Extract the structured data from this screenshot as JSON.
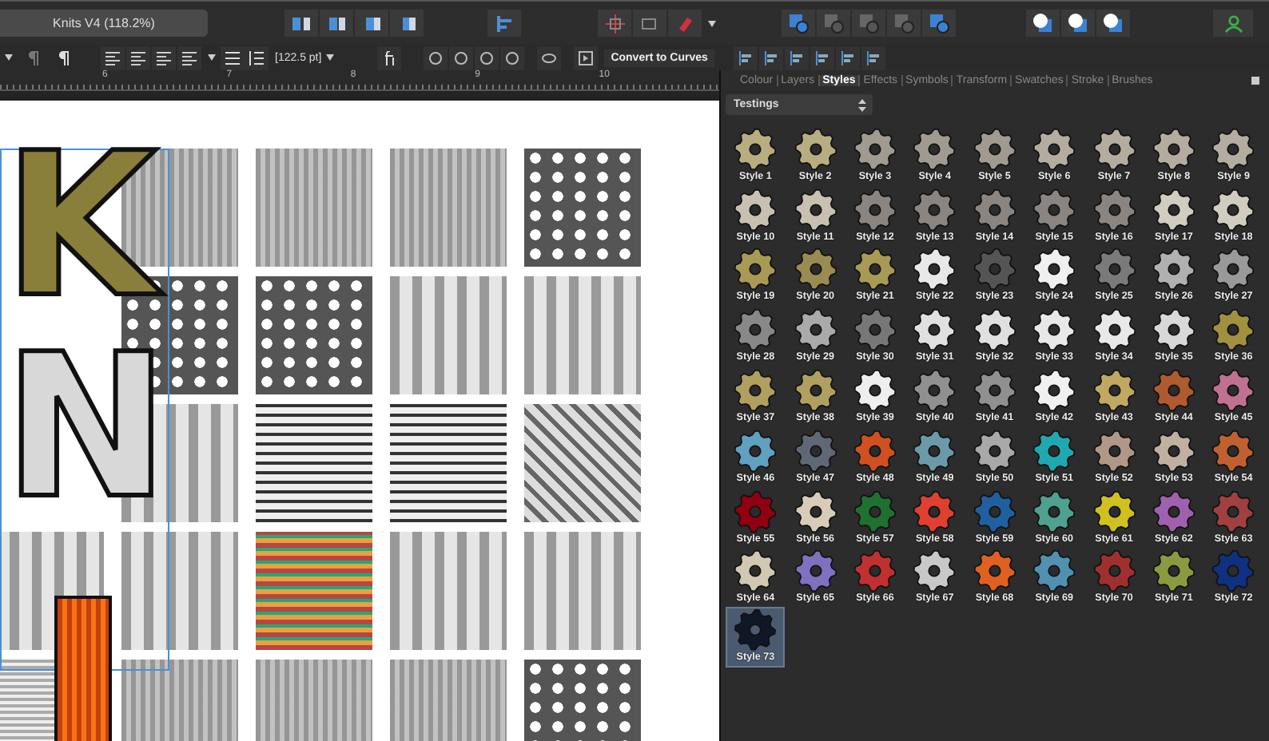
{
  "document": {
    "title": "Knits V4 (118.2%)"
  },
  "toolbar": {
    "size_field": "[122.5 pt]",
    "convert_button": "Convert to Curves"
  },
  "ruler": {
    "ticks": [
      "6",
      "7",
      "8",
      "9",
      "10"
    ]
  },
  "canvas": {
    "letters": [
      "K",
      "N"
    ]
  },
  "panel": {
    "tabs": [
      {
        "label": "Colour",
        "selected": false
      },
      {
        "label": "Layers",
        "selected": false
      },
      {
        "label": "Styles",
        "selected": true
      },
      {
        "label": "Effects",
        "selected": false
      },
      {
        "label": "Symbols",
        "selected": false
      },
      {
        "label": "Transform",
        "selected": false
      },
      {
        "label": "Swatches",
        "selected": false
      },
      {
        "label": "Stroke",
        "selected": false
      },
      {
        "label": "Brushes",
        "selected": false
      }
    ],
    "category": "Testings",
    "styles": [
      {
        "label": "Style 1",
        "color": "#b8ad80",
        "selected": false
      },
      {
        "label": "Style 2",
        "color": "#b8ad80",
        "selected": false
      },
      {
        "label": "Style 3",
        "color": "#a09a90",
        "selected": false
      },
      {
        "label": "Style 4",
        "color": "#a09a90",
        "selected": false
      },
      {
        "label": "Style 5",
        "color": "#a09a90",
        "selected": false
      },
      {
        "label": "Style 6",
        "color": "#b5aca0",
        "selected": false
      },
      {
        "label": "Style 7",
        "color": "#b5aca0",
        "selected": false
      },
      {
        "label": "Style 8",
        "color": "#b5aca0",
        "selected": false
      },
      {
        "label": "Style 9",
        "color": "#b5aca0",
        "selected": false
      },
      {
        "label": "Style 10",
        "color": "#c8c0b0",
        "selected": false
      },
      {
        "label": "Style 11",
        "color": "#c8c0b0",
        "selected": false
      },
      {
        "label": "Style 12",
        "color": "#8a8580",
        "selected": false
      },
      {
        "label": "Style 13",
        "color": "#8a8580",
        "selected": false
      },
      {
        "label": "Style 14",
        "color": "#8a8580",
        "selected": false
      },
      {
        "label": "Style 15",
        "color": "#8a8580",
        "selected": false
      },
      {
        "label": "Style 16",
        "color": "#8a8580",
        "selected": false
      },
      {
        "label": "Style 17",
        "color": "#d0ccc0",
        "selected": false
      },
      {
        "label": "Style 18",
        "color": "#d0ccc0",
        "selected": false
      },
      {
        "label": "Style 19",
        "color": "#a89a55",
        "selected": false
      },
      {
        "label": "Style 20",
        "color": "#9a8c50",
        "selected": false
      },
      {
        "label": "Style 21",
        "color": "#a89a55",
        "selected": false
      },
      {
        "label": "Style 22",
        "color": "#e8e8e8",
        "selected": false
      },
      {
        "label": "Style 23",
        "color": "#555555",
        "selected": false
      },
      {
        "label": "Style 24",
        "color": "#f0f0f0",
        "selected": false
      },
      {
        "label": "Style 25",
        "color": "#7a7a7a",
        "selected": false
      },
      {
        "label": "Style 26",
        "color": "#b0b0b0",
        "selected": false
      },
      {
        "label": "Style 27",
        "color": "#999999",
        "selected": false
      },
      {
        "label": "Style 28",
        "color": "#888888",
        "selected": false
      },
      {
        "label": "Style 29",
        "color": "#aaaaaa",
        "selected": false
      },
      {
        "label": "Style 30",
        "color": "#777777",
        "selected": false
      },
      {
        "label": "Style 31",
        "color": "#e0e0e0",
        "selected": false
      },
      {
        "label": "Style 32",
        "color": "#e0e0e0",
        "selected": false
      },
      {
        "label": "Style 33",
        "color": "#e8e8e8",
        "selected": false
      },
      {
        "label": "Style 34",
        "color": "#e8e8e8",
        "selected": false
      },
      {
        "label": "Style 35",
        "color": "#d8d8d8",
        "selected": false
      },
      {
        "label": "Style 36",
        "color": "#a09040",
        "selected": false
      },
      {
        "label": "Style 37",
        "color": "#b0a060",
        "selected": false
      },
      {
        "label": "Style 38",
        "color": "#b0a060",
        "selected": false
      },
      {
        "label": "Style 39",
        "color": "#eeeeee",
        "selected": false
      },
      {
        "label": "Style 40",
        "color": "#909090",
        "selected": false
      },
      {
        "label": "Style 41",
        "color": "#909090",
        "selected": false
      },
      {
        "label": "Style 42",
        "color": "#f0f0f0",
        "selected": false
      },
      {
        "label": "Style 43",
        "color": "#c0a860",
        "selected": false
      },
      {
        "label": "Style 44",
        "color": "#b05a30",
        "selected": false
      },
      {
        "label": "Style 45",
        "color": "#c07090",
        "selected": false
      },
      {
        "label": "Style 46",
        "color": "#60a0c0",
        "selected": false
      },
      {
        "label": "Style 47",
        "color": "#606878",
        "selected": false
      },
      {
        "label": "Style 48",
        "color": "#d05020",
        "selected": false
      },
      {
        "label": "Style 49",
        "color": "#6a9aa8",
        "selected": false
      },
      {
        "label": "Style 50",
        "color": "#a8a8a8",
        "selected": false
      },
      {
        "label": "Style 51",
        "color": "#20a8b0",
        "selected": false
      },
      {
        "label": "Style 52",
        "color": "#b09888",
        "selected": false
      },
      {
        "label": "Style 53",
        "color": "#c0b0a0",
        "selected": false
      },
      {
        "label": "Style 54",
        "color": "#c06030",
        "selected": false
      },
      {
        "label": "Style 55",
        "color": "#900010",
        "selected": false
      },
      {
        "label": "Style 56",
        "color": "#d8ccb8",
        "selected": false
      },
      {
        "label": "Style 57",
        "color": "#207030",
        "selected": false
      },
      {
        "label": "Style 58",
        "color": "#e04030",
        "selected": false
      },
      {
        "label": "Style 59",
        "color": "#2060a0",
        "selected": false
      },
      {
        "label": "Style 60",
        "color": "#50a090",
        "selected": false
      },
      {
        "label": "Style 61",
        "color": "#d0c020",
        "selected": false
      },
      {
        "label": "Style 62",
        "color": "#a060b0",
        "selected": false
      },
      {
        "label": "Style 63",
        "color": "#a04040",
        "selected": false
      },
      {
        "label": "Style 64",
        "color": "#d0c8b0",
        "selected": false
      },
      {
        "label": "Style 65",
        "color": "#8070c0",
        "selected": false
      },
      {
        "label": "Style 66",
        "color": "#c03030",
        "selected": false
      },
      {
        "label": "Style 67",
        "color": "#c8c8c8",
        "selected": false
      },
      {
        "label": "Style 68",
        "color": "#e06020",
        "selected": false
      },
      {
        "label": "Style 69",
        "color": "#5090b0",
        "selected": false
      },
      {
        "label": "Style 70",
        "color": "#a03030",
        "selected": false
      },
      {
        "label": "Style 71",
        "color": "#8a9a40",
        "selected": false
      },
      {
        "label": "Style 72",
        "color": "#103080",
        "selected": false
      },
      {
        "label": "Style 73",
        "color": "#101828",
        "selected": true
      }
    ]
  }
}
